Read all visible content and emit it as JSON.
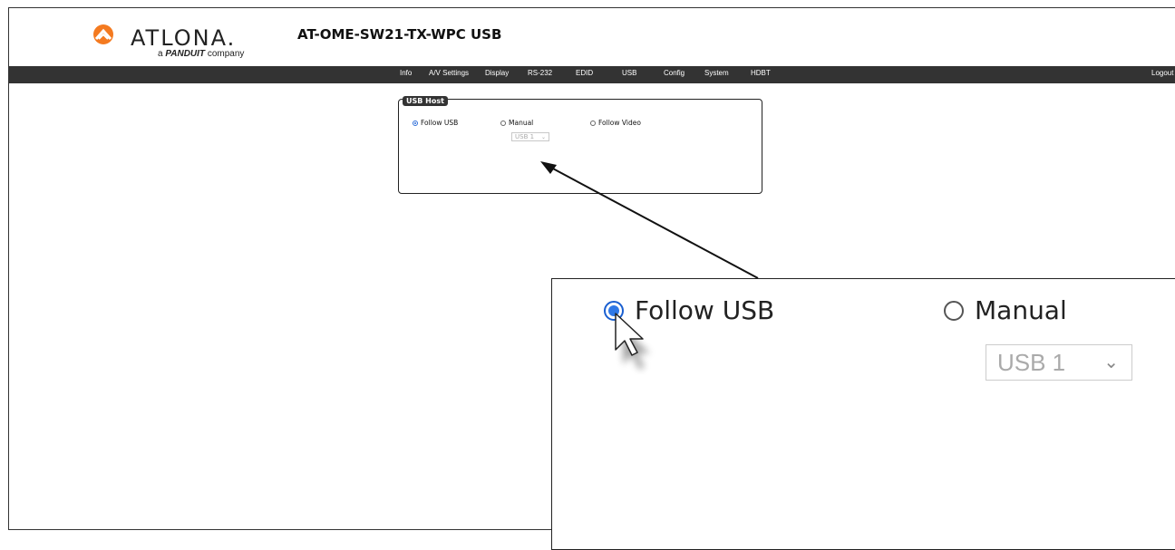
{
  "header": {
    "brand": "ATLONA.",
    "tagline_prefix": "a",
    "tagline_brand": "PANDUIT",
    "tagline_suffix": "company",
    "model": "AT-OME-SW21-TX-WPC   USB"
  },
  "nav": {
    "items": [
      "Info",
      "A/V Settings",
      "Display",
      "RS-232",
      "EDID",
      "USB",
      "Config",
      "System",
      "HDBT"
    ],
    "logout": "Logout"
  },
  "usb_host": {
    "legend": "USB Host",
    "options": [
      {
        "label": "Follow USB",
        "selected": true
      },
      {
        "label": "Manual",
        "selected": false
      },
      {
        "label": "Follow Video",
        "selected": false
      }
    ],
    "manual_select": {
      "value": "USB 1",
      "disabled": true
    }
  },
  "zoom_callout": {
    "options": [
      {
        "label": "Follow USB",
        "selected": true
      },
      {
        "label": "Manual",
        "selected": false
      }
    ],
    "select_value": "USB 1"
  },
  "colors": {
    "navbar": "#333333",
    "radio_selected": "#2f78e6",
    "logo_orange": "#f47a20"
  }
}
